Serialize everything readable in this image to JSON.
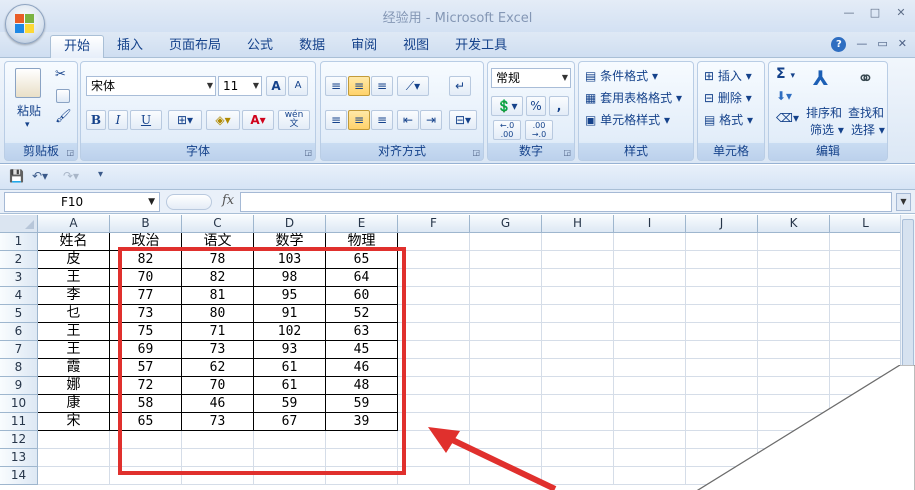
{
  "window": {
    "title": "经验用 - Microsoft Excel",
    "controls": [
      "—",
      "□",
      "✕"
    ]
  },
  "tabs": [
    "开始",
    "插入",
    "页面布局",
    "公式",
    "数据",
    "审阅",
    "视图",
    "开发工具"
  ],
  "active_tab": "开始",
  "ribbon": {
    "clipboard": {
      "label": "剪贴板",
      "paste": "粘贴"
    },
    "font": {
      "label": "字体",
      "font_name": "宋体",
      "font_size": "11",
      "grow": "A",
      "shrink": "A",
      "bold": "B",
      "italic": "I",
      "underline": "U",
      "font_color": "A",
      "phonetic": "wén"
    },
    "alignment": {
      "label": "对齐方式"
    },
    "number": {
      "label": "数字",
      "format": "常规",
      "percent": "%",
      "comma": ",",
      "inc_decimal": "←.0\n.00",
      "dec_decimal": ".00\n→.0"
    },
    "styles": {
      "label": "样式",
      "conditional": "条件格式",
      "table": "套用表格格式",
      "cell_styles": "单元格样式"
    },
    "cells": {
      "label": "单元格",
      "insert": "插入",
      "delete": "删除",
      "format": "格式"
    },
    "editing": {
      "label": "编辑",
      "sort_filter_1": "排序和",
      "sort_filter_2": "筛选",
      "find_1": "查找和",
      "find_2": "选择",
      "sum": "Σ"
    }
  },
  "formula_bar": {
    "name_box": "F10",
    "fx": "fx",
    "formula": ""
  },
  "grid": {
    "columns": [
      "A",
      "B",
      "C",
      "D",
      "E",
      "F",
      "G",
      "H",
      "I",
      "J",
      "K",
      "L"
    ],
    "rows": [
      "1",
      "2",
      "3",
      "4",
      "5",
      "6",
      "7",
      "8",
      "9",
      "10",
      "11",
      "12",
      "13",
      "14"
    ],
    "headers": [
      "姓名",
      "政治",
      "语文",
      "数学",
      "物理"
    ],
    "data": [
      [
        "皮",
        "82",
        "78",
        "103",
        "65"
      ],
      [
        "王",
        "70",
        "82",
        "98",
        "64"
      ],
      [
        "李",
        "77",
        "81",
        "95",
        "60"
      ],
      [
        "乜",
        "73",
        "80",
        "91",
        "52"
      ],
      [
        "王",
        "75",
        "71",
        "102",
        "63"
      ],
      [
        "王",
        "69",
        "73",
        "93",
        "45"
      ],
      [
        "霞",
        "57",
        "62",
        "61",
        "46"
      ],
      [
        "娜",
        "72",
        "70",
        "61",
        "48"
      ],
      [
        "康",
        "58",
        "46",
        "59",
        "59"
      ],
      [
        "宋",
        "65",
        "73",
        "67",
        "39"
      ]
    ]
  },
  "annotation": {
    "color": "#e0302d"
  }
}
